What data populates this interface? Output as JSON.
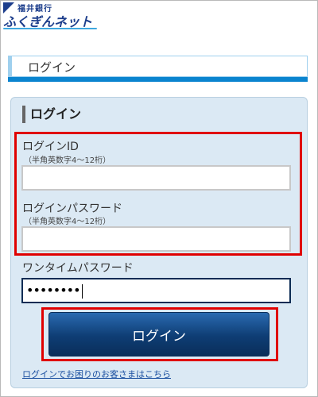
{
  "header": {
    "bank_name": "福井銀行",
    "service_name": "ふくぎんネット"
  },
  "page": {
    "heading": "ログイン"
  },
  "login_panel": {
    "title": "ログイン",
    "login_id": {
      "label": "ログインID",
      "hint": "（半角英数字4～12桁）",
      "value": ""
    },
    "password": {
      "label": "ログインパスワード",
      "hint": "（半角英数字4～12桁）",
      "value": ""
    },
    "one_time_password": {
      "label": "ワンタイムパスワード",
      "value": "••••••••"
    },
    "submit_label": "ログイン",
    "help_link": "ログインでお困りのお客さまはこちら"
  },
  "colors": {
    "brand": "#1d3e8c",
    "accent": "#0a84cf",
    "highlight": "#e00000",
    "button": "#0e3d74"
  }
}
